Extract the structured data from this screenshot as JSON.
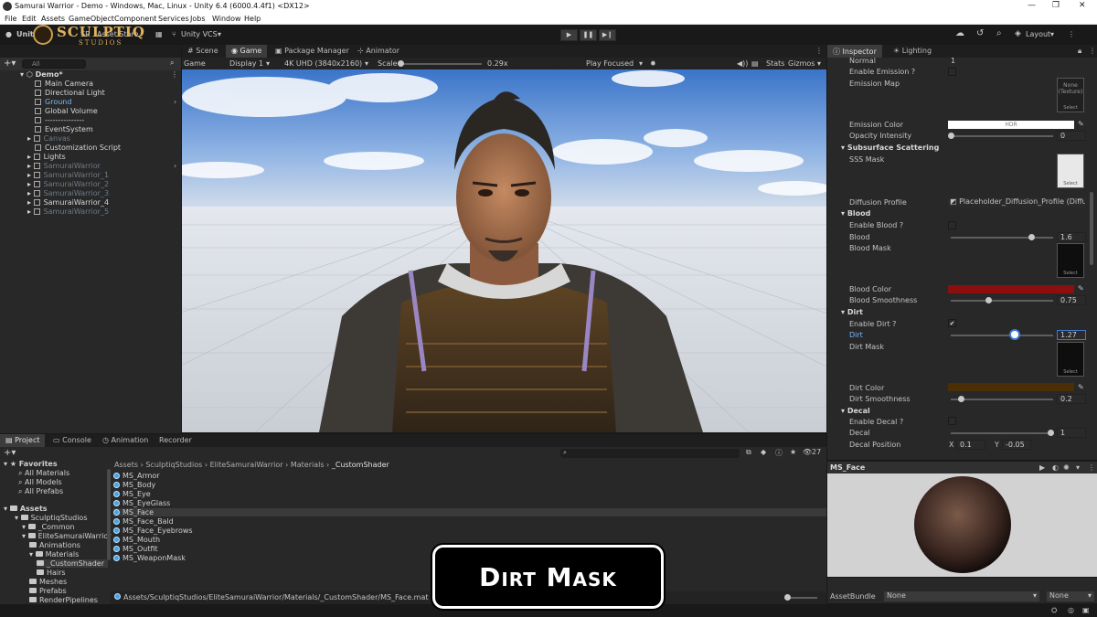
{
  "window": {
    "title": "Samurai Warrior - Demo - Windows, Mac, Linux - Unity 6.4 (6000.4.4f1) <DX12>"
  },
  "menu": [
    "File",
    "Edit",
    "Assets",
    "GameObject",
    "Component",
    "Services",
    "Jobs",
    "Window",
    "Help"
  ],
  "toolbar": {
    "account": "Unity",
    "sr": "SR",
    "asset_store": "Asset Store",
    "vcs": "Unity VCS",
    "layout": "Layout",
    "logo_line1": "SCULPTIQ",
    "logo_line2": "STUDIOS"
  },
  "hierarchy": {
    "search_placeholder": "All",
    "scene": "Demo*",
    "items": [
      {
        "label": "Main Camera",
        "style": "normal"
      },
      {
        "label": "Directional Light",
        "style": "normal"
      },
      {
        "label": "Ground",
        "style": "blue"
      },
      {
        "label": "Global Volume",
        "style": "normal"
      },
      {
        "label": "---------------",
        "style": "normal"
      },
      {
        "label": "EventSystem",
        "style": "normal"
      },
      {
        "label": "Canvas",
        "style": "dim"
      },
      {
        "label": "Customization Script",
        "style": "normal"
      },
      {
        "label": "Lights",
        "style": "normal"
      },
      {
        "label": "SamuraiWarrior",
        "style": "dimblue"
      },
      {
        "label": "SamuraiWarrior_1",
        "style": "dim"
      },
      {
        "label": "SamuraiWarrior_2",
        "style": "dim"
      },
      {
        "label": "SamuraiWarrior_3",
        "style": "dim"
      },
      {
        "label": "SamuraiWarrior_4",
        "style": "normal"
      },
      {
        "label": "SamuraiWarrior_5",
        "style": "dim"
      }
    ]
  },
  "center_tabs": [
    "Scene",
    "Game",
    "Package Manager",
    "Animator"
  ],
  "gamebar": {
    "mode": "Game",
    "display": "Display 1",
    "resolution": "4K UHD (3840x2160)",
    "scale_label": "Scale",
    "scale_value": "0.29x",
    "play_mode": "Play Focused",
    "stats": "Stats",
    "gizmos": "Gizmos"
  },
  "inspector": {
    "tabs": [
      "Inspector",
      "Lighting"
    ],
    "top_row_label": "Normal",
    "top_row_value": "1",
    "enable_emission": "Enable Emission ?",
    "emission_map": "Emission Map",
    "emission_map_thumb": "None (Texture)",
    "select": "Select",
    "emission_color": "Emission Color",
    "hdr": "HDR",
    "opacity_intensity": "Opacity Intensity",
    "opacity_value": "0",
    "sss_head": "Subsurface Scattering",
    "sss_mask": "SSS Mask",
    "diffusion_profile": "Diffusion Profile",
    "diffusion_value": "Placeholder_Diffusion_Profile (Diffus",
    "blood_head": "Blood",
    "enable_blood": "Enable Blood ?",
    "blood": "Blood",
    "blood_value": "1.6",
    "blood_mask": "Blood Mask",
    "blood_color": "Blood Color",
    "blood_smoothness": "Blood Smoothness",
    "blood_smoothness_value": "0.75",
    "dirt_head": "Dirt",
    "enable_dirt": "Enable Dirt ?",
    "dirt": "Dirt",
    "dirt_value": "1.27",
    "dirt_mask": "Dirt Mask",
    "dirt_color": "Dirt Color",
    "dirt_smoothness": "Dirt Smoothness",
    "dirt_smoothness_value": "0.2",
    "decal_head": "Decal",
    "enable_decal": "Enable Decal ?",
    "decal": "Decal",
    "decal_value": "1",
    "decal_position": "Decal Position",
    "decal_x_label": "X",
    "decal_x": "0.1",
    "decal_y_label": "Y",
    "decal_y": "-0.05",
    "check_mark": "✔",
    "colors": {
      "emission": "#ffffff",
      "blood": "#8b0f0f",
      "dirt": "#4a2e06"
    }
  },
  "preview": {
    "title": "MS_Face",
    "assetbundle_label": "AssetBundle",
    "assetbundle_value": "None",
    "variant_value": "None"
  },
  "bottom_tabs": [
    "Project",
    "Console",
    "Animation",
    "Recorder"
  ],
  "project": {
    "badge": "27",
    "favorites_head": "Favorites",
    "favorites": [
      "All Materials",
      "All Models",
      "All Prefabs"
    ],
    "assets_head": "Assets",
    "tree": [
      {
        "label": "SculptiqStudios",
        "indent": 1
      },
      {
        "label": "_Common",
        "indent": 2
      },
      {
        "label": "EliteSamuraiWarrior",
        "indent": 2
      },
      {
        "label": "Animations",
        "indent": 3
      },
      {
        "label": "Materials",
        "indent": 3
      },
      {
        "label": "_CustomShader",
        "indent": 4
      },
      {
        "label": "Hairs",
        "indent": 4
      },
      {
        "label": "Meshes",
        "indent": 3
      },
      {
        "label": "Prefabs",
        "indent": 3
      },
      {
        "label": "RenderPipelines",
        "indent": 3
      }
    ],
    "breadcrumb": [
      "Assets",
      "SculptiqStudios",
      "EliteSamuraiWarrior",
      "Materials",
      "_CustomShader"
    ],
    "files": [
      "MS_Armor",
      "MS_Body",
      "MS_Eye",
      "MS_EyeGlass",
      "MS_Face",
      "MS_Face_Bald",
      "MS_Face_Eyebrows",
      "MS_Mouth",
      "MS_Outfit",
      "MS_WeaponMask"
    ],
    "selected_file_index": 4,
    "path": "Assets/SculptiqStudios/EliteSamuraiWarrior/Materials/_CustomShader/MS_Face.mat"
  },
  "overlay": {
    "caption": "Dirt Mask"
  }
}
